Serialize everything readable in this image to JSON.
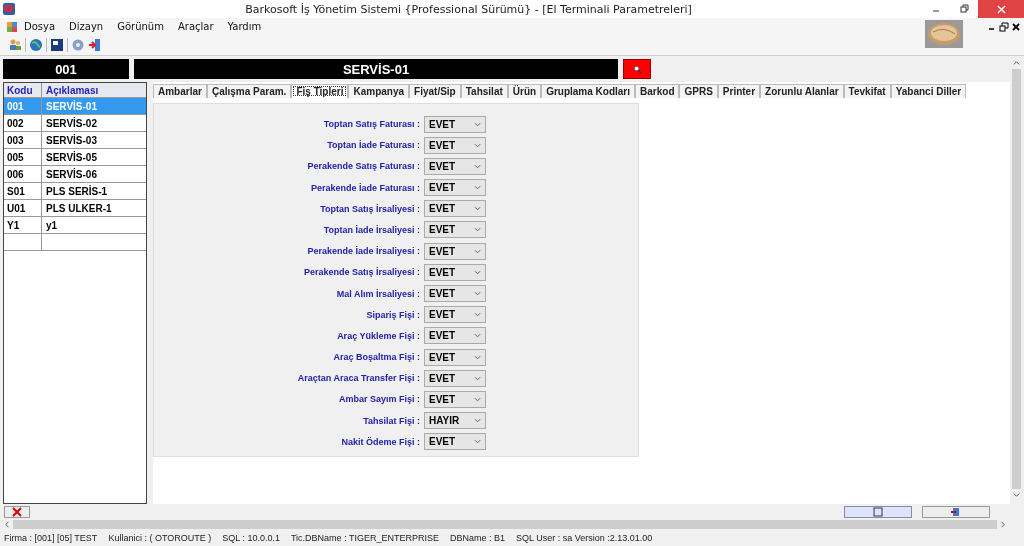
{
  "window": {
    "title": "Barkosoft İş Yönetim Sistemi {Professional Sürümü} - [El Terminali Parametreleri]"
  },
  "menu": [
    "Dosya",
    "Dizayn",
    "Görünüm",
    "Araçlar",
    "Yardım"
  ],
  "header": {
    "code": "001",
    "name": "SERVİS-01"
  },
  "list": {
    "columns": [
      "Kodu",
      "Açıklaması"
    ],
    "rows": [
      {
        "code": "001",
        "name": "SERVİS-01",
        "selected": true
      },
      {
        "code": "002",
        "name": "SERVİS-02",
        "selected": false
      },
      {
        "code": "003",
        "name": "SERVİS-03",
        "selected": false
      },
      {
        "code": "005",
        "name": "SERVİS-05",
        "selected": false
      },
      {
        "code": "006",
        "name": "SERVİS-06",
        "selected": false
      },
      {
        "code": "S01",
        "name": "PLS SERİS-1",
        "selected": false
      },
      {
        "code": "U01",
        "name": "PLS ULKER-1",
        "selected": false
      },
      {
        "code": "Y1",
        "name": "y1",
        "selected": false
      }
    ]
  },
  "tabs": [
    {
      "label": "Ambarlar",
      "selected": false
    },
    {
      "label": "Çalışma Param.",
      "selected": false
    },
    {
      "label": "Fiş Tipleri",
      "selected": true
    },
    {
      "label": "Kampanya",
      "selected": false
    },
    {
      "label": "Fiyat/Sip",
      "selected": false
    },
    {
      "label": "Tahsilat",
      "selected": false
    },
    {
      "label": "Ürün",
      "selected": false
    },
    {
      "label": "Gruplama Kodları",
      "selected": false
    },
    {
      "label": "Barkod",
      "selected": false
    },
    {
      "label": "GPRS",
      "selected": false
    },
    {
      "label": "Printer",
      "selected": false
    },
    {
      "label": "Zorunlu Alanlar",
      "selected": false
    },
    {
      "label": "Tevkifat",
      "selected": false
    },
    {
      "label": "Yabanci Diller",
      "selected": false
    }
  ],
  "fields": [
    {
      "label": "Toptan Satış Faturası :",
      "value": "EVET"
    },
    {
      "label": "Toptan İade Faturası :",
      "value": "EVET"
    },
    {
      "label": "Perakende Satış Faturası :",
      "value": "EVET"
    },
    {
      "label": "Perakende İade Faturası :",
      "value": "EVET"
    },
    {
      "label": "Toptan Satış İrsaliyesi :",
      "value": "EVET"
    },
    {
      "label": "Toptan İade İrsaliyesi :",
      "value": "EVET"
    },
    {
      "label": "Perakende İade İrsaliyesi :",
      "value": "EVET"
    },
    {
      "label": "Perakende Satış İrsaliyesi :",
      "value": "EVET"
    },
    {
      "label": "Mal Alım İrsaliyesi :",
      "value": "EVET"
    },
    {
      "label": "Sipariş Fişi :",
      "value": "EVET"
    },
    {
      "label": "Araç Yükleme Fişi :",
      "value": "EVET"
    },
    {
      "label": "Araç Boşaltma Fişi :",
      "value": "EVET"
    },
    {
      "label": "Araçtan Araca Transfer Fişi :",
      "value": "EVET"
    },
    {
      "label": "Ambar Sayım Fişi :",
      "value": "EVET"
    },
    {
      "label": "Tahsilat Fişi :",
      "value": "HAYIR"
    },
    {
      "label": "Nakit Ödeme Fişi :",
      "value": "EVET"
    }
  ],
  "status_bar": [
    "Firma : [001] [05]  TEST",
    "Kullanici : ( OTOROUTE )",
    "SQL : 10.0.0.1",
    "Tic.DBName : TIGER_ENTERPRISE",
    "DBName : B1",
    "SQL User : sa  Version :2.13.01.00"
  ]
}
